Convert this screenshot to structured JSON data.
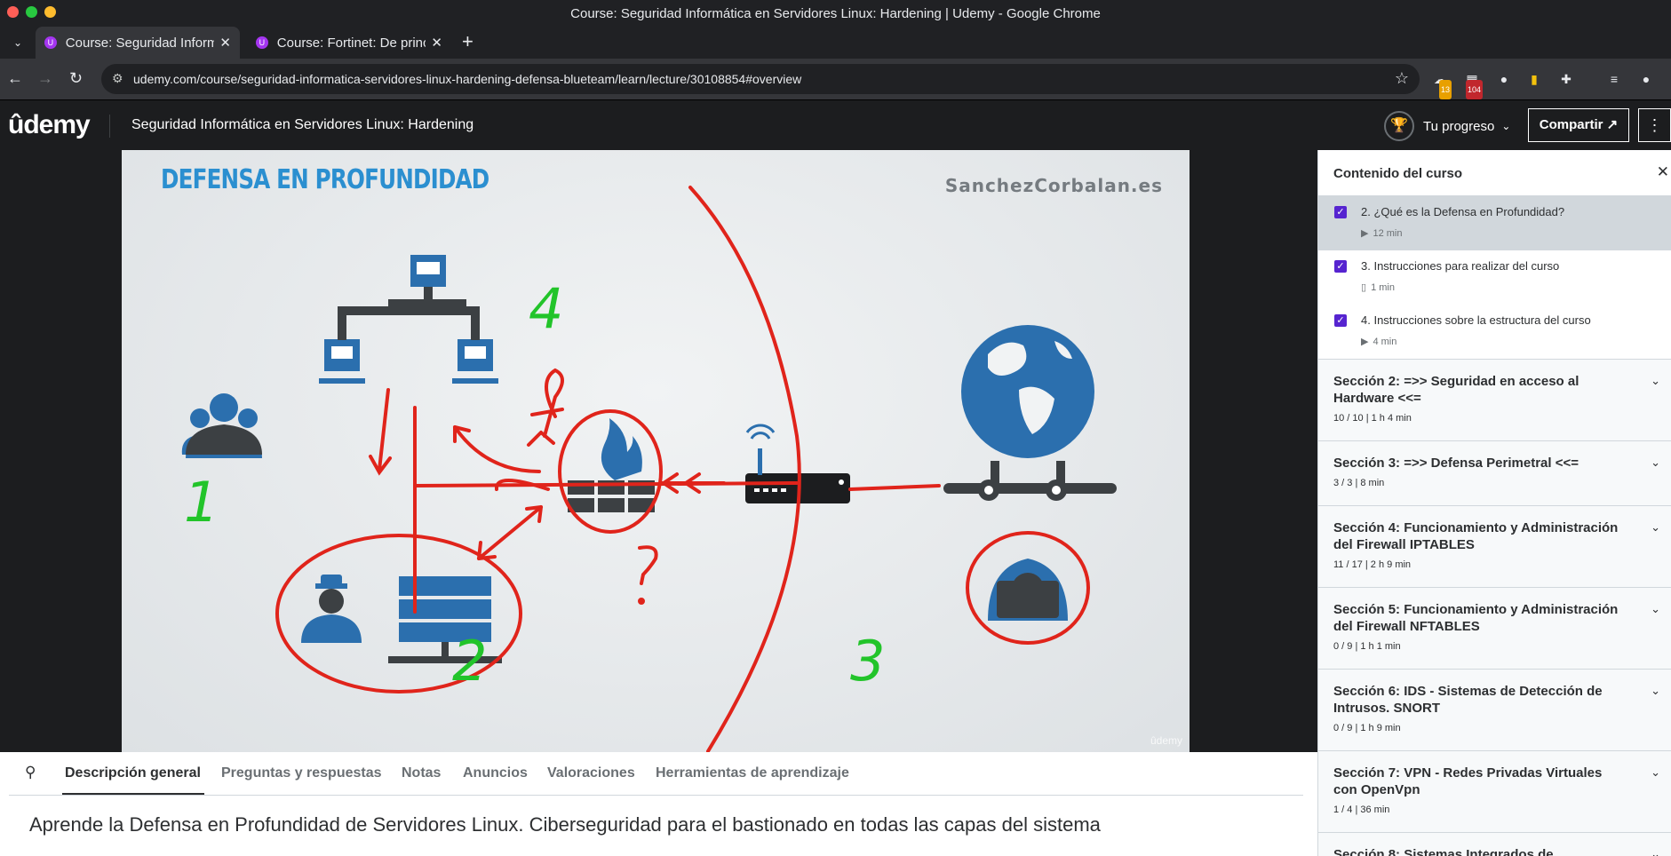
{
  "browser": {
    "window_title": "Course: Seguridad Informática en Servidores Linux: Hardening | Udemy - Google Chrome",
    "tabs": [
      {
        "title": "Course: Seguridad Informática en Servidores Linux: Hardening",
        "favicon": "udemy-icon"
      },
      {
        "title": "Course: Fortinet: De principiante a experto",
        "favicon": "udemy-icon"
      }
    ],
    "url": "udemy.com/course/seguridad-informatica-servidores-linux-hardening-defensa-blueteam/learn/lecture/30108854#overview",
    "ext_badge_1": "13",
    "ext_badge_2": "104"
  },
  "header": {
    "logo": "ûdemy",
    "course_title": "Seguridad Informática en Servidores Linux: Hardening",
    "progress_label": "Tu progreso",
    "share_label": "Compartir",
    "share_icon": "↗"
  },
  "slide": {
    "title": "DEFENSA EN PROFUNDIDAD",
    "brand": "SanchezCorbalan.es",
    "watermark": "ûdemy",
    "annotations": [
      "1",
      "2",
      "3",
      "4",
      "?"
    ]
  },
  "lecture_tabs": [
    {
      "label": "Descripción general",
      "active": true
    },
    {
      "label": "Preguntas y respuestas",
      "active": false
    },
    {
      "label": "Notas",
      "active": false
    },
    {
      "label": "Anuncios",
      "active": false
    },
    {
      "label": "Valoraciones",
      "active": false
    },
    {
      "label": "Herramientas de aprendizaje",
      "active": false
    }
  ],
  "lecture_heading": "Aprende la Defensa en Profundidad de Servidores Linux. Ciberseguridad para el bastionado en todas las capas del sistema",
  "sidebar": {
    "heading": "Contenido del curso",
    "lectures": [
      {
        "label": "2. ¿Qué es la Defensa en Profundidad?",
        "meta": "12 min",
        "icon": "video-icon",
        "checked": true,
        "active": true
      },
      {
        "label": "3. Instrucciones para realizar del curso",
        "meta": "1 min",
        "icon": "file-icon",
        "checked": true,
        "active": false
      },
      {
        "label": "4. Instrucciones sobre la estructura del curso",
        "meta": "4 min",
        "icon": "video-icon",
        "checked": true,
        "active": false
      }
    ],
    "sections": [
      {
        "title": "Sección 2: =>> Seguridad en acceso al Hardware <<=",
        "meta": "10 / 10 | 1 h 4 min"
      },
      {
        "title": "Sección 3: =>> Defensa Perimetral <<=",
        "meta": "3 / 3 | 8 min"
      },
      {
        "title": "Sección 4: Funcionamiento y Administración del Firewall IPTABLES",
        "meta": "11 / 17 | 2 h 9 min"
      },
      {
        "title": "Sección 5: Funcionamiento y Administración del Firewall NFTABLES",
        "meta": "0 / 9 | 1 h 1 min"
      },
      {
        "title": "Sección 6: IDS - Sistemas de Detección de Intrusos. SNORT",
        "meta": "0 / 9 | 1 h 9 min"
      },
      {
        "title": "Sección 7: VPN - Redes Privadas Virtuales con OpenVpn",
        "meta": "1 / 4 | 36 min"
      },
      {
        "title": "Sección 8: Sistemas Integrados de",
        "meta": ""
      }
    ]
  },
  "colors": {
    "udemy_purple": "#a435f0",
    "checkbox": "#5624d0",
    "header_bg": "#1c1d1f",
    "slide_blue": "#2b8fd0",
    "annotation_red": "#e0241b",
    "annotation_green": "#22c42a"
  }
}
